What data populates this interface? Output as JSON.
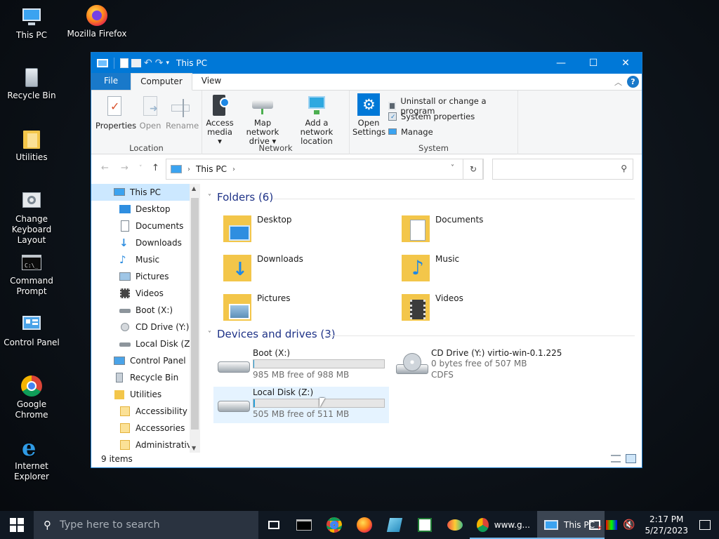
{
  "desktop": {
    "icons": [
      {
        "name": "desktop-icon-this-pc",
        "label": "This PC"
      },
      {
        "name": "desktop-icon-firefox",
        "label": "Mozilla Firefox"
      },
      {
        "name": "desktop-icon-recycle-bin",
        "label": "Recycle Bin"
      },
      {
        "name": "desktop-icon-utilities",
        "label": "Utilities"
      },
      {
        "name": "desktop-icon-change-keyboard",
        "label": "Change Keyboard Layout"
      },
      {
        "name": "desktop-icon-command-prompt",
        "label": "Command Prompt"
      },
      {
        "name": "desktop-icon-control-panel",
        "label": "Control Panel"
      },
      {
        "name": "desktop-icon-chrome",
        "label": "Google Chrome"
      },
      {
        "name": "desktop-icon-ie",
        "label": "Internet Explorer"
      }
    ]
  },
  "window": {
    "title": "This PC",
    "controls": {
      "minimize": "—",
      "maximize": "☐",
      "close": "✕"
    },
    "tabs": {
      "file": "File",
      "computer": "Computer",
      "view": "View"
    },
    "help": "?",
    "ribbon": {
      "location": {
        "label": "Location",
        "properties": "Properties",
        "open": "Open",
        "rename": "Rename"
      },
      "network": {
        "label": "Network",
        "access_media_1": "Access",
        "access_media_2": "media",
        "map_drive_1": "Map network",
        "map_drive_2": "drive",
        "add_location_1": "Add a network",
        "add_location_2": "location"
      },
      "system": {
        "label": "System",
        "open_settings_1": "Open",
        "open_settings_2": "Settings",
        "uninstall": "Uninstall or change a program",
        "system_properties": "System properties",
        "manage": "Manage"
      }
    },
    "address": {
      "path": "This PC",
      "search_placeholder": ""
    },
    "nav": {
      "this_pc": "This PC",
      "items": [
        "Desktop",
        "Documents",
        "Downloads",
        "Music",
        "Pictures",
        "Videos",
        "Boot (X:)",
        "CD Drive (Y:) vi",
        "Local Disk (Z:)"
      ],
      "control_panel": "Control Panel",
      "recycle_bin": "Recycle Bin",
      "utilities": "Utilities",
      "sub": [
        "Accessibility",
        "Accessories",
        "Administrative"
      ]
    },
    "folders_header": "Folders (6)",
    "folders": [
      "Desktop",
      "Documents",
      "Downloads",
      "Music",
      "Pictures",
      "Videos"
    ],
    "drives_header": "Devices and drives (3)",
    "drives": {
      "boot": {
        "name": "Boot (X:)",
        "free": "985 MB free of 988 MB",
        "used_fraction": 0.003
      },
      "cd": {
        "name": "CD Drive (Y:) virtio-win-0.1.225",
        "free": "0 bytes free of 507 MB",
        "fs": "CDFS"
      },
      "local": {
        "name": "Local Disk (Z:)",
        "free": "505 MB free of 511 MB",
        "used_fraction": 0.012
      }
    },
    "status": "9 items"
  },
  "taskbar": {
    "search_placeholder": "Type here to search",
    "apps": [
      {
        "label": "www.g..."
      },
      {
        "label": "This PC"
      }
    ],
    "time": "2:17 PM",
    "date": "5/27/2023"
  },
  "colors": {
    "accent": "#0078d7",
    "folder": "#f3c64a",
    "taskbar": "#101822"
  }
}
